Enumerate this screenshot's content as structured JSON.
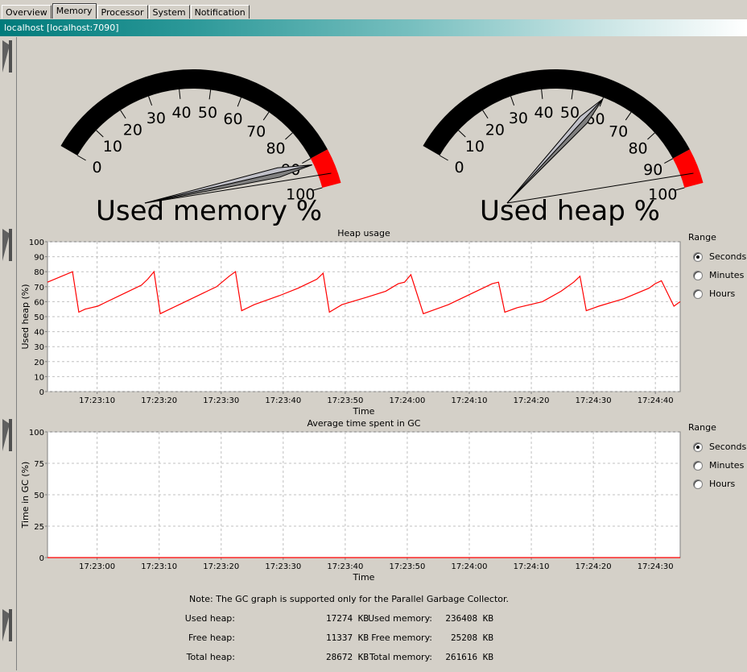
{
  "tabs": [
    {
      "label": "Overview",
      "active": false
    },
    {
      "label": "Memory",
      "active": true
    },
    {
      "label": "Processor",
      "active": false
    },
    {
      "label": "System",
      "active": false
    },
    {
      "label": "Notification",
      "active": false
    }
  ],
  "connection_title": "localhost [localhost:7090]",
  "gauges": {
    "ticks": [
      "0",
      "10",
      "20",
      "30",
      "40",
      "50",
      "60",
      "70",
      "80",
      "90",
      "100"
    ],
    "memory": {
      "title": "Used memory %",
      "value": 92
    },
    "heap": {
      "title": "Used heap %",
      "value": 60
    }
  },
  "chart_data": [
    {
      "type": "line",
      "title": "Heap usage",
      "xlabel": "Time",
      "ylabel": "Used heap (%)",
      "ylim": [
        0,
        100
      ],
      "yticks": [
        0,
        10,
        20,
        30,
        40,
        50,
        60,
        70,
        80,
        90,
        100
      ],
      "xticks": [
        "17:23:10",
        "17:23:20",
        "17:23:30",
        "17:23:40",
        "17:23:50",
        "17:24:00",
        "17:24:10",
        "17:24:20",
        "17:24:30",
        "17:24:40"
      ],
      "series_color": "#ff0000",
      "x": [
        0,
        4,
        5,
        6,
        8,
        12,
        15,
        16,
        17,
        18,
        22,
        25,
        27,
        29,
        30,
        31,
        33,
        37,
        40,
        43,
        44,
        45,
        47,
        51,
        54,
        56,
        57,
        58,
        60,
        62,
        64,
        68,
        71,
        72,
        73,
        75,
        79,
        82,
        84,
        85,
        86,
        88,
        92,
        96,
        97,
        98,
        100,
        101
      ],
      "values": [
        73,
        80,
        53,
        55,
        57,
        65,
        71,
        75,
        80,
        52,
        60,
        66,
        70,
        77,
        80,
        54,
        58,
        64,
        69,
        75,
        79,
        53,
        58,
        63,
        67,
        72,
        73,
        78,
        52,
        55,
        58,
        66,
        72,
        73,
        53,
        56,
        60,
        67,
        73,
        77,
        54,
        57,
        62,
        69,
        72,
        74,
        57,
        60
      ]
    },
    {
      "type": "line",
      "title": "Average time spent in GC",
      "xlabel": "Time",
      "ylabel": "Time in GC (%)",
      "ylim": [
        0,
        100
      ],
      "yticks": [
        0,
        25,
        50,
        75,
        100
      ],
      "xticks": [
        "17:23:00",
        "17:23:10",
        "17:23:20",
        "17:23:30",
        "17:23:40",
        "17:23:50",
        "17:24:00",
        "17:24:10",
        "17:24:20",
        "17:24:30"
      ],
      "series_color": "#ff0000",
      "x": [
        0,
        100
      ],
      "values": [
        0,
        0
      ]
    }
  ],
  "range_panels": [
    {
      "title": "Range",
      "options": [
        {
          "label": "Seconds",
          "selected": true
        },
        {
          "label": "Minutes",
          "selected": false
        },
        {
          "label": "Hours",
          "selected": false
        }
      ]
    },
    {
      "title": "Range",
      "options": [
        {
          "label": "Seconds",
          "selected": true
        },
        {
          "label": "Minutes",
          "selected": false
        },
        {
          "label": "Hours",
          "selected": false
        }
      ]
    }
  ],
  "note": "Note: The GC graph is supported only for the Parallel Garbage Collector.",
  "summary": {
    "used_heap_label": "Used heap:",
    "used_heap": "17274 KB",
    "free_heap_label": "Free heap:",
    "free_heap": "11337 KB",
    "total_heap_label": "Total heap:",
    "total_heap": "28672 KB",
    "used_memory_label": "Used memory:",
    "used_memory": "236408 KB",
    "free_memory_label": "Free memory:",
    "free_memory": "25208 KB",
    "total_memory_label": "Total memory:",
    "total_memory": "261616 KB"
  }
}
